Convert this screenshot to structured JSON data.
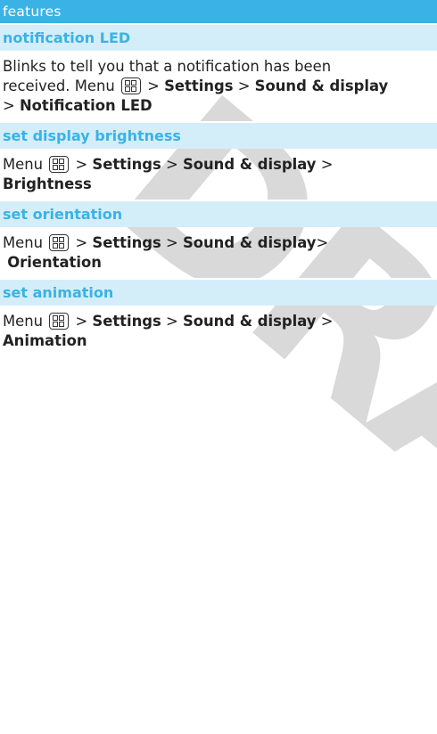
{
  "watermark": "DRAFT",
  "header": {
    "title": "features"
  },
  "sections": [
    {
      "title": "notification LED",
      "line1": "Blinks to tell you that a notification has been",
      "pre": "received. Menu",
      "sep1": ">",
      "item1": "Settings",
      "sep2": ">",
      "item2": "Sound & display",
      "sep3": ">",
      "item3": "Notification LED"
    },
    {
      "title": "set display brightness",
      "pre": "Menu",
      "sep1": ">",
      "item1": "Settings",
      "sep2": ">",
      "item2": "Sound & display",
      "sep3": ">",
      "item3": "Brightness"
    },
    {
      "title": "set orientation",
      "pre": "Menu",
      "sep1": ">",
      "item1": "Settings",
      "sep2": ">",
      "item2": "Sound & display",
      "sep3": ">",
      "item3": "Orientation"
    },
    {
      "title": "set animation",
      "pre": "Menu",
      "sep1": ">",
      "item1": "Settings",
      "sep2": ">",
      "item2": "Sound & display",
      "sep3": ">",
      "item3": "Animation"
    }
  ],
  "icons": {
    "menu_key": "menu-key-icon"
  },
  "colors": {
    "accent": "#3ab2e6",
    "title_band": "#d4eef9",
    "watermark": "#d9d9d9"
  }
}
